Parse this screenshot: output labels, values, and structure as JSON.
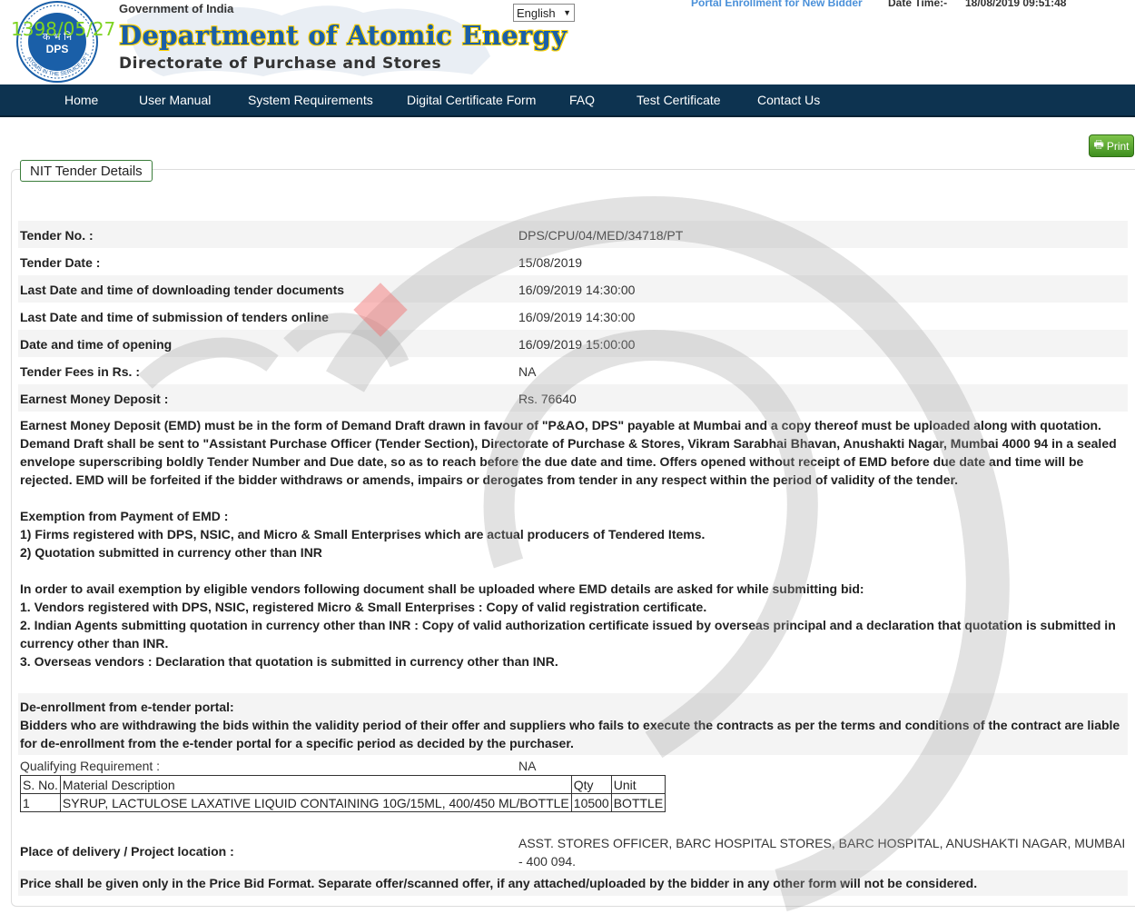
{
  "header": {
    "stamp": "1398/05/27",
    "gov_label": "Government of India",
    "dept_name": "Department of Atomic Energy",
    "directorate": "Directorate of Purchase and Stores",
    "logo_text": "DPS",
    "logo_hindi": "क भ नि",
    "logo_ring": "ATOMS IN THE SERVICE OF THE NATION",
    "language": "English",
    "portal_link": "Portal Enrollment for New Bidder",
    "datetime_label": "Date Time:-",
    "datetime_value": "18/08/2019 09:51:48"
  },
  "nav": {
    "items": [
      "Home",
      "User Manual",
      "System Requirements",
      "Digital Certificate Form",
      "FAQ",
      "Test Certificate",
      "Contact Us"
    ]
  },
  "print_label": "Print",
  "panel_title": "NIT Tender Details",
  "details": [
    {
      "label": "Tender No. :",
      "value": "DPS/CPU/04/MED/34718/PT"
    },
    {
      "label": "Tender Date :",
      "value": "15/08/2019"
    },
    {
      "label": "Last Date and time of downloading tender documents",
      "value": "16/09/2019 14:30:00"
    },
    {
      "label": "Last Date and time of submission of tenders online",
      "value": "16/09/2019 14:30:00"
    },
    {
      "label": "Date and time of opening",
      "value": "16/09/2019 15:00:00"
    },
    {
      "label": "Tender Fees in Rs. :",
      "value": "NA"
    },
    {
      "label": "Earnest Money Deposit :",
      "value": "Rs. 76640"
    }
  ],
  "emd_text": "Earnest Money Deposit (EMD) must be in the form of Demand Draft drawn in favour of \"P&AO, DPS\" payable at Mumbai and a copy thereof must be uploaded along with quotation. Demand Draft shall be sent to \"Assistant Purchase Officer (Tender Section), Directorate of Purchase & Stores, Vikram Sarabhai Bhavan, Anushakti Nagar, Mumbai 4000 94 in a sealed envelope superscribing boldly Tender Number and Due date, so as to reach before the due date and time. Offers opened without receipt of EMD before due date and time will be rejected. EMD will be forfeited if the bidder withdraws or amends, impairs or derogates from tender in any respect within the period of validity of the tender.",
  "exemption": {
    "title": "Exemption from Payment of EMD :",
    "line1": "1) Firms registered with DPS, NSIC, and Micro & Small Enterprises which are actual producers of Tendered Items.",
    "line2": "2) Quotation submitted in currency other than INR"
  },
  "avail": {
    "intro": "In order to avail exemption by eligible vendors following document shall be uploaded where EMD details are asked for while submitting bid:",
    "line1": "1. Vendors registered with DPS, NSIC, registered Micro & Small Enterprises : Copy of valid registration certificate.",
    "line2": "2. Indian Agents submitting quotation in currency other than INR : Copy of valid authorization certificate issued by overseas principal and a declaration that quotation is submitted in currency other than INR.",
    "line3": "3. Overseas vendors : Declaration that quotation is submitted in currency other than INR."
  },
  "deenroll": {
    "title": "De-enrollment from e-tender portal:",
    "text": "Bidders who are withdrawing the bids within the validity period of their offer and suppliers who fails to execute the contracts as per the terms and conditions of the contract are liable for de-enrollment from the e-tender portal for a specific period as decided by the purchaser."
  },
  "qualifying": {
    "label": "Qualifying Requirement :",
    "value": "NA"
  },
  "items_table": {
    "headers": [
      "S. No.",
      "Material Description",
      "Qty",
      "Unit"
    ],
    "rows": [
      [
        "1",
        "SYRUP, LACTULOSE LAXATIVE LIQUID CONTAINING 10G/15ML, 400/450 ML/BOTTLE",
        "10500",
        "BOTTLE"
      ]
    ]
  },
  "delivery": {
    "label": "Place of delivery / Project location :",
    "value": "ASST. STORES OFFICER, BARC HOSPITAL STORES, BARC HOSPITAL, ANUSHAKTI NAGAR, MUMBAI - 400 094."
  },
  "price_note": "Price shall be given only in the Price Bid Format. Separate offer/scanned offer, if any attached/uploaded by the bidder in any other form will not be considered.",
  "colors": {
    "nav_bg": "#0d3350",
    "brand_blue": "#1a5fa8",
    "print_green": "#4ea42a"
  }
}
